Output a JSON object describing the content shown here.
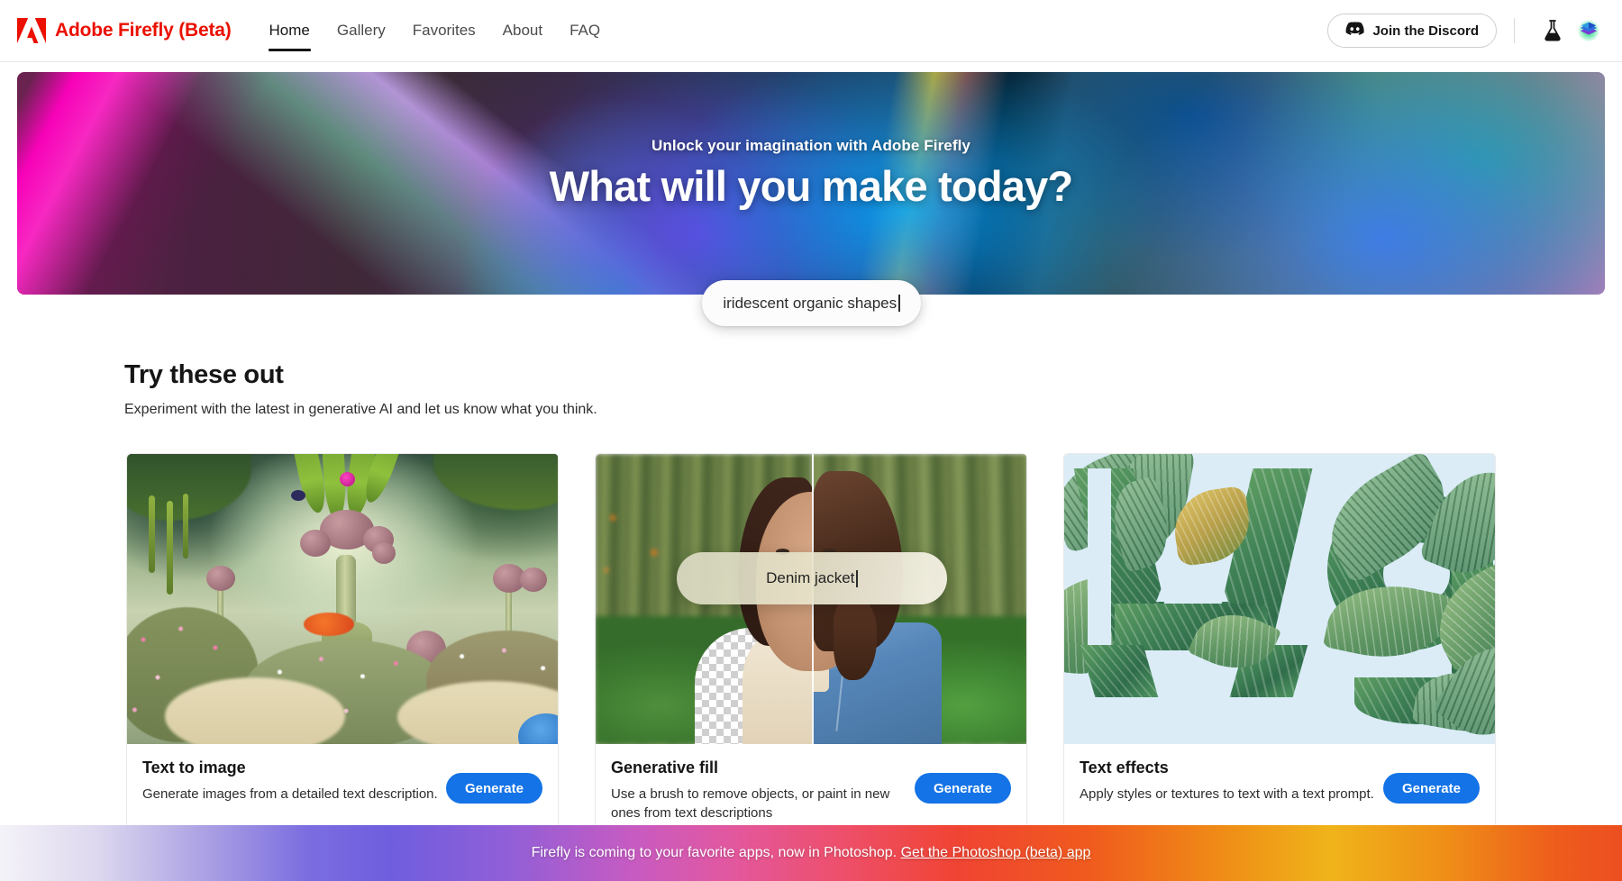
{
  "header": {
    "brand": "Adobe Firefly (Beta)",
    "logo_icon": "adobe-a-logo",
    "nav": [
      {
        "label": "Home",
        "active": true
      },
      {
        "label": "Gallery",
        "active": false
      },
      {
        "label": "Favorites",
        "active": false
      },
      {
        "label": "About",
        "active": false
      },
      {
        "label": "FAQ",
        "active": false
      }
    ],
    "discord": {
      "label": "Join the Discord",
      "icon": "discord-icon"
    },
    "beta_icon": "flask-icon",
    "app_switcher_icon": "adobe-cloud-stack-icon"
  },
  "hero": {
    "kicker": "Unlock your imagination with Adobe Firefly",
    "title": "What will you make today?",
    "prompt_value": "iridescent organic shapes"
  },
  "section": {
    "title": "Try these out",
    "subtitle": "Experiment with the latest in generative AI and let us know what you think."
  },
  "cards": [
    {
      "title": "Text to image",
      "desc": "Generate images from a detailed text description.",
      "cta": "Generate",
      "art": "fantasy-garden-with-mushroom-plants"
    },
    {
      "title": "Generative fill",
      "desc": "Use a brush to remove objects, or paint in new ones from text descriptions",
      "cta": "Generate",
      "art": "portrait-before-after-split",
      "overlay_prompt": "Denim jacket"
    },
    {
      "title": "Text effects",
      "desc": "Apply styles or textures to text with a text prompt.",
      "cta": "Generate",
      "art": "leaf-textured-letters-Ag"
    }
  ],
  "footer": {
    "text": "Firefly is coming to your favorite apps, now in Photoshop.",
    "link": "Get the Photoshop (beta) app"
  },
  "colors": {
    "adobe_red": "#EB1000",
    "accent_blue": "#1473E6",
    "text_primary": "#151515",
    "text_secondary": "#2C2C2C"
  }
}
